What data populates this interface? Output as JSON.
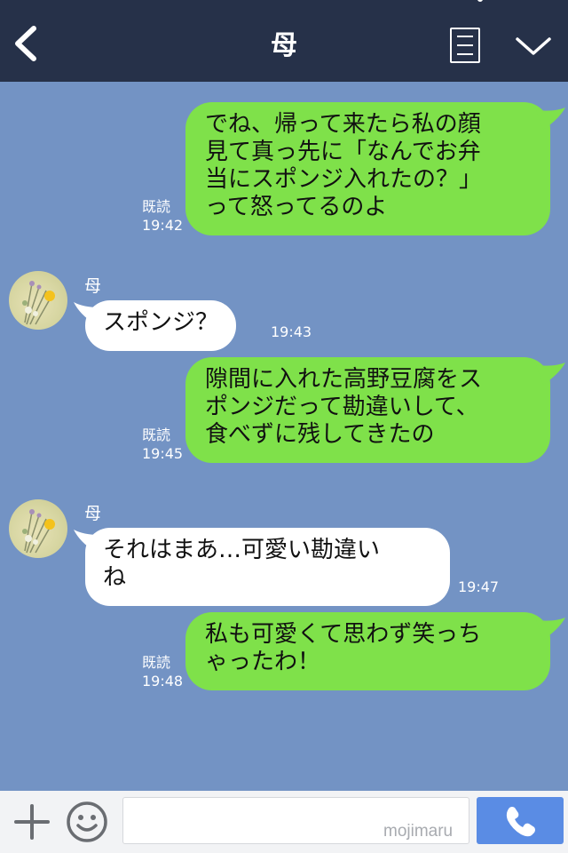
{
  "header": {
    "title": "母",
    "back_icon": "chevron-left-icon",
    "menu_icon": "note-list-icon",
    "more_icon": "chevron-down-icon",
    "bg_color": "#263149"
  },
  "chat": {
    "bg_color": "#7393c4",
    "outgoing_color": "#7fe14a",
    "incoming_color": "#ffffff",
    "messages": [
      {
        "direction": "out",
        "text": "でね、帰って来たら私の顔\n見て真っ先に「なんでお弁\n当にスポンジ入れたの？」\nって怒ってるのよ",
        "read": "既読",
        "time": "19:42"
      },
      {
        "direction": "in",
        "sender": "母",
        "text": "スポンジ？",
        "time": "19:43"
      },
      {
        "direction": "out",
        "text": "隙間に入れた高野豆腐をス\nポンジだって勘違いして、\n食べずに残してきたの",
        "read": "既読",
        "time": "19:45"
      },
      {
        "direction": "in",
        "sender": "母",
        "text": "それはまあ…可愛い勘違い\nね",
        "time": "19:47"
      },
      {
        "direction": "out",
        "text": "私も可愛くて思わず笑っち\nゃったわ！",
        "read": "既読",
        "time": "19:48"
      }
    ]
  },
  "input_bar": {
    "plus_icon": "plus-icon",
    "emoji_icon": "smiley-icon",
    "input_value": "",
    "watermark": "mojimaru",
    "call_icon": "phone-icon",
    "call_color": "#5a8ce4"
  }
}
